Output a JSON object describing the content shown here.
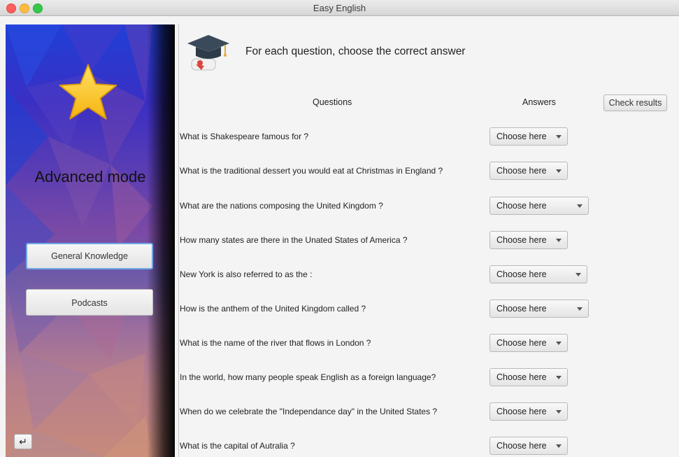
{
  "window": {
    "title": "Easy English"
  },
  "sidebar": {
    "mode_label": "Advanced mode",
    "buttons": [
      "General Knowledge",
      "Podcasts"
    ],
    "back_symbol": "↵"
  },
  "main": {
    "instruction": "For each question, choose the correct answer",
    "questions_header": "Questions",
    "answers_header": "Answers",
    "check_button": "Check results",
    "dropdown_placeholder": "Choose here",
    "questions": [
      "What is Shakespeare famous for ?",
      "What is the traditional dessert you would eat at Christmas in England ?",
      "What are the nations composing the United Kingdom ?",
      "How many states are there in the Unated States of America ?",
      "New York is also referred to as the :",
      "How is the anthem of the United Kingdom called ?",
      "What is the name of the river that flows in London ?",
      "In the world, how many people speak English as a foreign language?",
      "When do we celebrate the \"Independance day\" in the United States ?",
      "What is the capital of Autralia ?"
    ]
  },
  "icons": {
    "star": "star-icon",
    "graduation": "graduation-cap-icon",
    "back": "return-arrow-icon"
  }
}
